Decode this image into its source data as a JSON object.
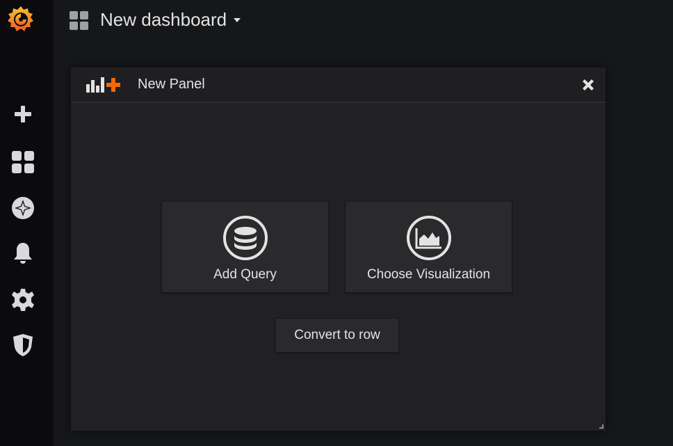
{
  "app": {
    "brand_color": "#f46800"
  },
  "sidebar": {
    "logo": {
      "icon": "grafana-logo-icon"
    },
    "items": [
      {
        "name": "create",
        "icon": "plus-icon"
      },
      {
        "name": "dashboards",
        "icon": "grid-icon"
      },
      {
        "name": "explore",
        "icon": "compass-icon"
      },
      {
        "name": "alerting",
        "icon": "bell-icon"
      },
      {
        "name": "configuration",
        "icon": "gear-icon"
      },
      {
        "name": "server-admin",
        "icon": "shield-icon"
      }
    ]
  },
  "header": {
    "dashboard_icon": "dashboard-grid-icon",
    "dashboard_title": "New dashboard"
  },
  "panel": {
    "title": "New Panel",
    "header_icon": "add-panel-icon",
    "close_icon": "close-icon",
    "actions": [
      {
        "label": "Add Query",
        "icon": "database-icon"
      },
      {
        "label": "Choose Visualization",
        "icon": "area-chart-icon"
      }
    ],
    "convert_label": "Convert to row"
  },
  "colors": {
    "background": "#161719",
    "sidebar": "#0b0b0d",
    "panel": "#212124",
    "card": "#2a2a2d",
    "accent_orange": "#f46800",
    "text": "#e3e3e3"
  }
}
